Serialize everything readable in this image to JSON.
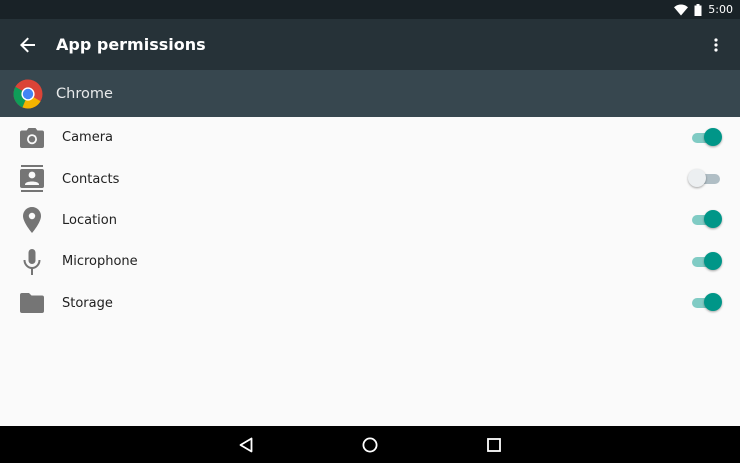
{
  "status_bar": {
    "time": "5:00",
    "icons": [
      "wifi-icon",
      "battery-icon"
    ]
  },
  "app_bar": {
    "title": "App permissions",
    "back_icon": "arrow-back-icon",
    "overflow_icon": "more-vert-icon"
  },
  "app_header": {
    "name": "Chrome",
    "icon": "chrome-logo-icon"
  },
  "permissions": [
    {
      "label": "Camera",
      "icon": "camera-icon",
      "enabled": true
    },
    {
      "label": "Contacts",
      "icon": "contacts-icon",
      "enabled": false
    },
    {
      "label": "Location",
      "icon": "location-pin-icon",
      "enabled": true
    },
    {
      "label": "Microphone",
      "icon": "microphone-icon",
      "enabled": true
    },
    {
      "label": "Storage",
      "icon": "folder-icon",
      "enabled": true
    }
  ],
  "nav_bar": {
    "icons": [
      "back-triangle-icon",
      "home-circle-icon",
      "recents-square-icon"
    ]
  },
  "colors": {
    "status_bar": "#192227",
    "app_bar": "#263238",
    "app_header": "#37474f",
    "accent": "#009688",
    "icon_gray": "#757575"
  }
}
